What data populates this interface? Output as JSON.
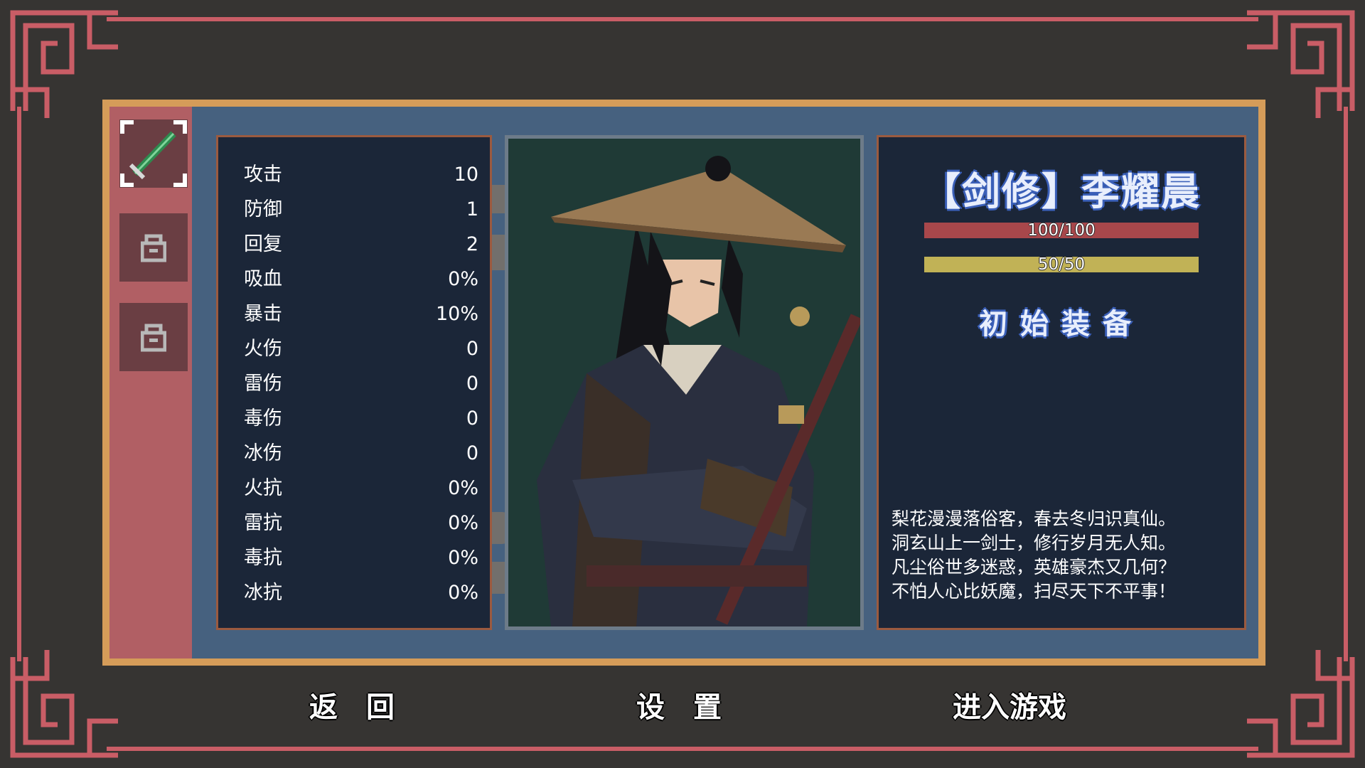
{
  "colors": {
    "background": "#363432",
    "frame": "#c95d66",
    "panel_border": "#d59c59",
    "panel_fill": "#46617f",
    "card_fill": "#1b2638",
    "hp_bar": "#a8474b",
    "mp_bar": "#c1b256"
  },
  "slots": [
    {
      "icon": "sword-icon",
      "state": "selected"
    },
    {
      "icon": "lock-icon",
      "state": "locked"
    },
    {
      "icon": "lock-icon",
      "state": "locked"
    }
  ],
  "stats": [
    {
      "label": "攻击",
      "value": "10"
    },
    {
      "label": "防御",
      "value": "1"
    },
    {
      "label": "回复",
      "value": "2"
    },
    {
      "label": "吸血",
      "value": "0%"
    },
    {
      "label": "暴击",
      "value": "10%"
    },
    {
      "label": "火伤",
      "value": "0"
    },
    {
      "label": "雷伤",
      "value": "0"
    },
    {
      "label": "毒伤",
      "value": "0"
    },
    {
      "label": "冰伤",
      "value": "0"
    },
    {
      "label": "火抗",
      "value": "0%"
    },
    {
      "label": "雷抗",
      "value": "0%"
    },
    {
      "label": "毒抗",
      "value": "0%"
    },
    {
      "label": "冰抗",
      "value": "0%"
    }
  ],
  "character": {
    "name": "【剑修】李耀晨",
    "hp": {
      "text": "100/100",
      "current": 100,
      "max": 100
    },
    "mp": {
      "text": "50/50",
      "current": 50,
      "max": 50
    },
    "equipment_label": "初始装备",
    "poem": [
      "梨花漫漫落俗客，春去冬归识真仙。",
      "洞玄山上一剑士，修行岁月无人知。",
      "凡尘俗世多迷惑，英雄豪杰又几何？",
      "不怕人心比妖魔，扫尽天下不平事！"
    ]
  },
  "buttons": {
    "back": "返　回",
    "settings": "设　置",
    "enter": "进入游戏"
  }
}
